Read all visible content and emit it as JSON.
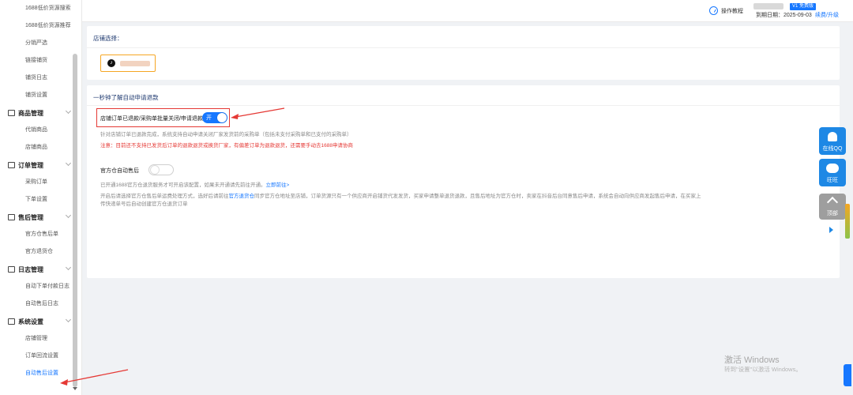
{
  "sidebar": {
    "items": [
      {
        "type": "sub",
        "label": "1688低价货源搜索"
      },
      {
        "type": "sub",
        "label": "1688低价货源推荐"
      },
      {
        "type": "sub",
        "label": "分销严选"
      },
      {
        "type": "sub",
        "label": "链接铺货"
      },
      {
        "type": "sub",
        "label": "铺货日志"
      },
      {
        "type": "sub",
        "label": "铺货设置"
      },
      {
        "type": "group",
        "label": "商品管理",
        "icon": "store-icon"
      },
      {
        "type": "sub",
        "label": "代销商品"
      },
      {
        "type": "sub",
        "label": "店铺商品"
      },
      {
        "type": "group",
        "label": "订单管理",
        "icon": "order-icon"
      },
      {
        "type": "sub",
        "label": "采购订单"
      },
      {
        "type": "sub",
        "label": "下单设置"
      },
      {
        "type": "group",
        "label": "售后管理",
        "icon": "after-sale-icon"
      },
      {
        "type": "sub",
        "label": "官方仓售后单"
      },
      {
        "type": "sub",
        "label": "官方退货仓"
      },
      {
        "type": "group",
        "label": "日志管理",
        "icon": "log-icon"
      },
      {
        "type": "sub",
        "label": "自动下单付款日志"
      },
      {
        "type": "sub",
        "label": "自动售后日志"
      },
      {
        "type": "group",
        "label": "系统设置",
        "icon": "settings-icon"
      },
      {
        "type": "sub",
        "label": "店铺管理"
      },
      {
        "type": "sub",
        "label": "订单回流设置"
      },
      {
        "type": "sub",
        "label": "自动售后设置",
        "active": true
      }
    ]
  },
  "header": {
    "tutorial": "操作教程",
    "version_badge": "V1 免费版",
    "expire_label": "到期日期：2025-09-03",
    "renew": "续费/升级"
  },
  "shop_card": {
    "title": "店铺选择：",
    "shop_icon": "tiktok-icon"
  },
  "refund_card": {
    "title": "一秒钟了解自动申请退款",
    "auto_refund": {
      "label": "店铺订单已退款/采购单批量关闭/申请退款",
      "toggle_text": "开",
      "on": true,
      "desc": "针对店铺订单已退款完成，系统支持自动申请关闭厂家发货前的采购单（包括未支付采购单和已支付的采购单）",
      "warn": "注意：目前还不支持已发货后订单的退款退货或换货厂家，有偏差订单为退款退货，还需要手动去1688申请协商"
    },
    "official": {
      "label": "官方仓自动售后",
      "on": false,
      "desc1_prefix": "已开通1688官方仓退货服务才可开启该配置，如果未开通请先前往开通。",
      "desc1_link": "立即前往>",
      "desc2_prefix": "开启后请选择官方仓售后单运费处理方式，选好后请前往",
      "desc2_link": "官方退货仓",
      "desc2_suffix": "同步官方仓地址至店铺，订单货源只有一个供应商开启铺货代发发货，买家申请整单退货退款，且售后地址为官方仓时，卖家在抖音后台同意售后申请，系统会自动向供应商发起售后申请，在买家上",
      "desc3": "传快递单号后自动创建官方仓退货订单"
    }
  },
  "float_buttons": {
    "qq": "在线QQ",
    "wangwang": "旺旺",
    "top": "顶部"
  },
  "watermark": {
    "line1": "激活 Windows",
    "line2": "转到\"设置\"以激活 Windows。"
  },
  "colors": {
    "accent": "#1677ff",
    "warn": "#e53935",
    "highlight": "#f5a623"
  }
}
